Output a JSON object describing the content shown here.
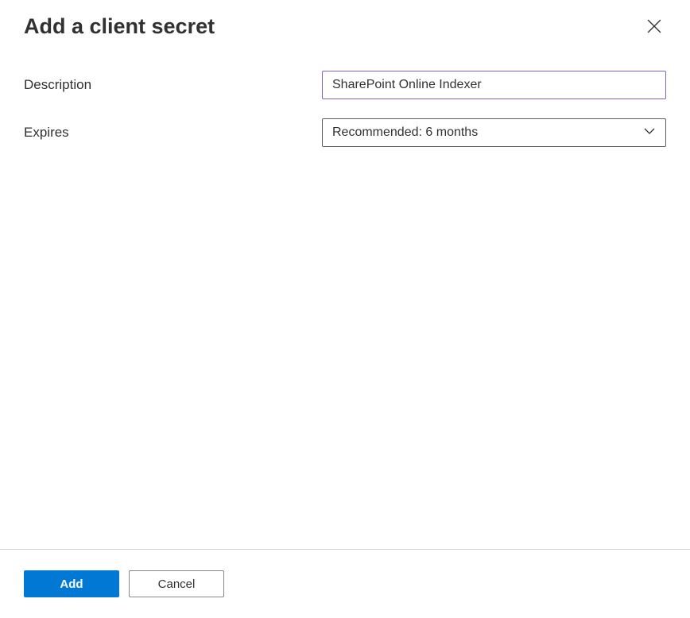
{
  "header": {
    "title": "Add a client secret"
  },
  "form": {
    "description_label": "Description",
    "description_value": "SharePoint Online Indexer",
    "expires_label": "Expires",
    "expires_value": "Recommended: 6 months"
  },
  "footer": {
    "add_label": "Add",
    "cancel_label": "Cancel"
  }
}
